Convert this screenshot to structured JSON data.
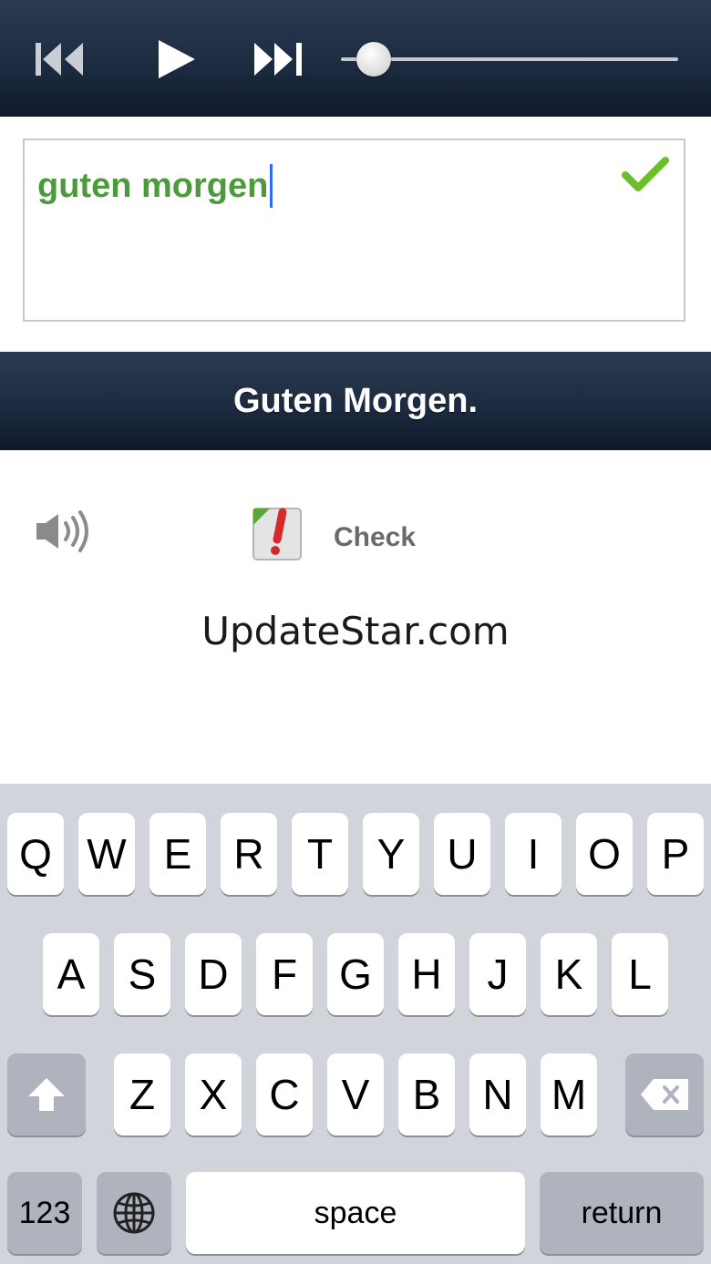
{
  "player": {
    "prev_icon": "skip-back-icon",
    "play_icon": "play-icon",
    "next_icon": "skip-forward-icon",
    "progress": 0.05
  },
  "answer": {
    "value": "guten morgen",
    "status_icon": "checkmark-icon",
    "status_color": "#6bbf2a"
  },
  "solution": {
    "text": "Guten Morgen."
  },
  "actions": {
    "speaker_icon": "speaker-icon",
    "check_icon": "check-exclamation-icon",
    "check_label": "Check"
  },
  "watermark": "UpdateStar.com",
  "keyboard": {
    "row1": [
      "Q",
      "W",
      "E",
      "R",
      "T",
      "Y",
      "U",
      "I",
      "O",
      "P"
    ],
    "row2": [
      "A",
      "S",
      "D",
      "F",
      "G",
      "H",
      "J",
      "K",
      "L"
    ],
    "row3": [
      "Z",
      "X",
      "C",
      "V",
      "B",
      "N",
      "M"
    ],
    "numbers_label": "123",
    "space_label": "space",
    "return_label": "return",
    "shift_icon": "shift-arrow-icon",
    "globe_icon": "globe-icon",
    "backspace_icon": "backspace-icon"
  },
  "colors": {
    "bar_dark": "#1b2a3e",
    "answer_green": "#4b9a3b",
    "caret_blue": "#2f6bff",
    "keyboard_bg": "#d1d4db"
  }
}
